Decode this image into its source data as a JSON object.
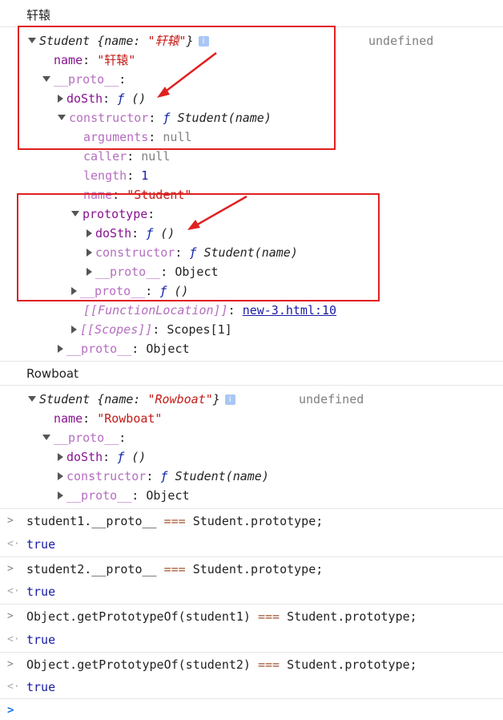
{
  "log1": {
    "label": "轩辕"
  },
  "obj1": {
    "summary_cls": "Student",
    "summary_open": " {name: ",
    "summary_val": "\"轩辕\"",
    "summary_close": "}",
    "info_glyph": "i",
    "undefined": "undefined",
    "name_key": "name",
    "name_val": "\"轩辕\"",
    "proto_key": "__proto__",
    "dosth_key": "doSth",
    "f_sym": "ƒ",
    "f_parens": " ()",
    "constructor_key": "constructor",
    "constructor_val": " Student(name)",
    "arguments_key": "arguments",
    "null_val": "null",
    "caller_key": "caller",
    "length_key": "length",
    "length_val": "1",
    "fn_name_key": "name",
    "fn_name_val": "\"Student\"",
    "prototype_key": "prototype",
    "object_val": "Object",
    "funcloc_key": "[[FunctionLocation]]",
    "funcloc_val": "new-3.html:10",
    "scopes_key": "[[Scopes]]",
    "scopes_val": "Scopes[1]"
  },
  "log2": {
    "label": "Rowboat"
  },
  "obj2": {
    "summary_cls": "Student",
    "summary_open": " {name: ",
    "summary_val": "\"Rowboat\"",
    "summary_close": "}",
    "undefined": "undefined",
    "name_val": "\"Rowboat\""
  },
  "commands": [
    {
      "prefix": "student1.__proto__ ",
      "op": "===",
      "suffix": " Student.prototype;",
      "result": "true"
    },
    {
      "prefix": "student2.__proto__ ",
      "op": "===",
      "suffix": " Student.prototype;",
      "result": "true"
    },
    {
      "prefix": "Object.getPrototypeOf(student1) ",
      "op": "===",
      "suffix": " Student.prototype;",
      "result": "true"
    },
    {
      "prefix": "Object.getPrototypeOf(student2) ",
      "op": "===",
      "suffix": " Student.prototype;",
      "result": "true"
    }
  ],
  "colors": {
    "highlight": "#e02020",
    "key": "#881391",
    "string": "#c41a16",
    "number": "#1a1aa6",
    "prompt": "#1a73e8"
  }
}
